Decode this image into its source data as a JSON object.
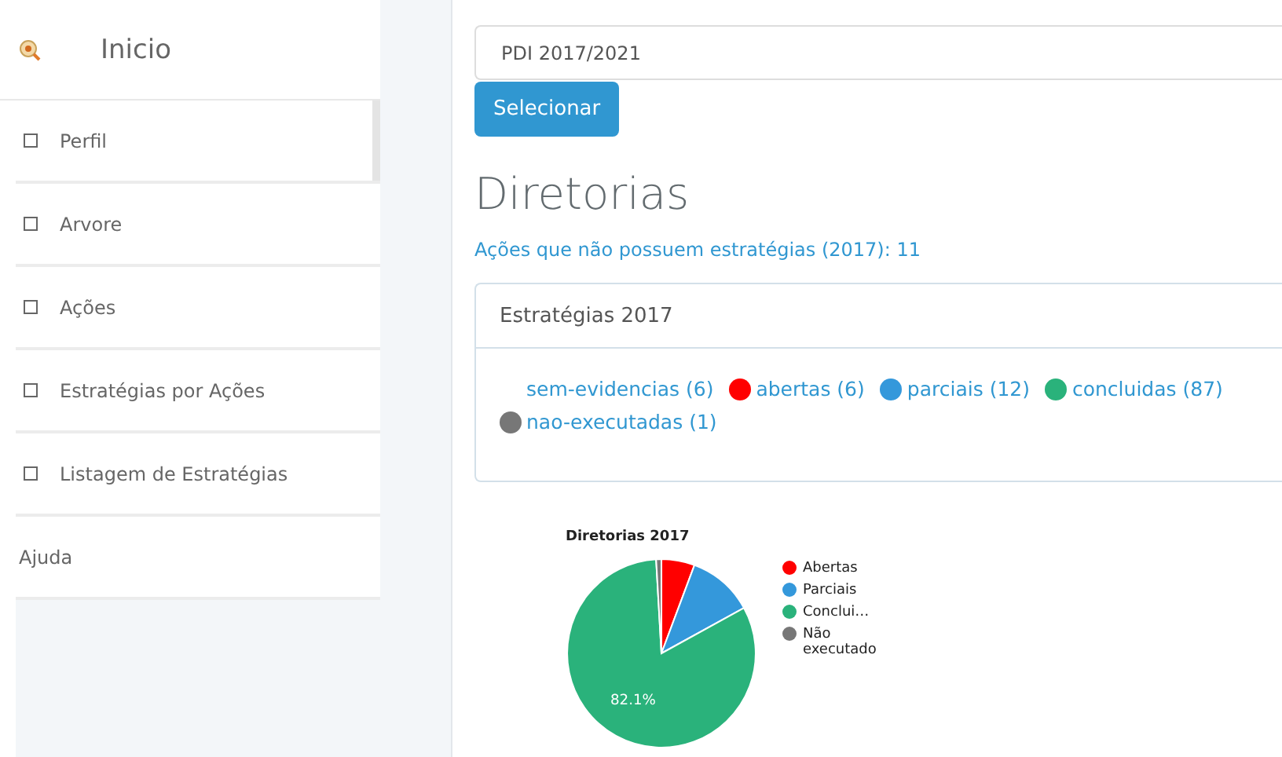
{
  "sidebar": {
    "home": {
      "label": "Inicio"
    },
    "items": [
      {
        "label": "Perfil",
        "kind": "checkbox",
        "selected": true
      },
      {
        "label": "Arvore",
        "kind": "checkbox",
        "selected": false
      },
      {
        "label": "Ações",
        "kind": "checkbox",
        "selected": false
      },
      {
        "label": "Estratégias por Ações",
        "kind": "checkbox",
        "selected": false
      },
      {
        "label": "Listagem de Estratégias",
        "kind": "checkbox",
        "selected": false
      },
      {
        "label": "Ajuda",
        "kind": "plain",
        "selected": false
      }
    ]
  },
  "plan_select": {
    "value": "PDI 2017/2021"
  },
  "select_button": "Selecionar",
  "heading": "Diretorias",
  "missing_link": "Ações que não possuem estratégias (2017): 11",
  "panel": {
    "title": "Estratégias 2017",
    "statuses": [
      {
        "label": "sem-evidencias (6)"
      },
      {
        "label": "abertas (6)",
        "color": "#ff0000"
      },
      {
        "label": "parciais (12)",
        "color": "#3498db"
      },
      {
        "label": "concluidas (87)",
        "color": "#2ab27b"
      },
      {
        "label": "nao-executadas (1)",
        "color": "#777777"
      }
    ]
  },
  "chart_data": {
    "type": "pie",
    "title": "Diretorias 2017",
    "categories": [
      "Abertas",
      "Parciais",
      "Conclui…",
      "Não executado"
    ],
    "values": [
      5.7,
      11.3,
      82.1,
      0.9
    ],
    "colors": [
      "#ff0000",
      "#3498db",
      "#2ab27b",
      "#777777"
    ],
    "value_labels": [
      null,
      null,
      "82.1%",
      null
    ],
    "legend": true
  }
}
